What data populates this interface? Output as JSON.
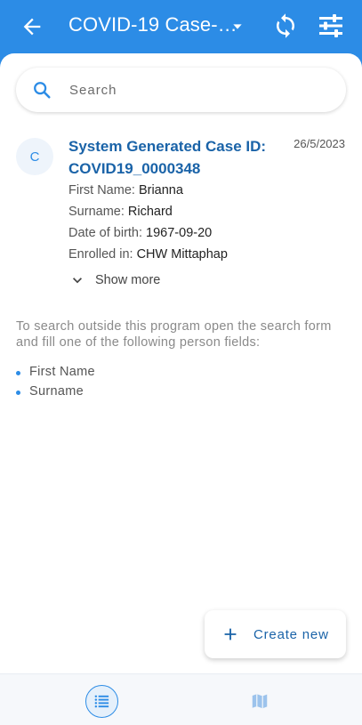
{
  "header": {
    "title": "COVID-19 Case-…"
  },
  "search": {
    "placeholder": "Search"
  },
  "card": {
    "avatar_letter": "C",
    "case_id_line1": "System Generated Case ID:",
    "case_id_line2": "COVID19_0000348",
    "date": "26/5/2023",
    "attributes": [
      {
        "label": "First Name:",
        "value": "Brianna"
      },
      {
        "label": "Surname:",
        "value": "Richard"
      },
      {
        "label": "Date of birth:",
        "value": "1967-09-20"
      },
      {
        "label": "Enrolled in:",
        "value": "CHW Mittaphap"
      }
    ],
    "show_more": "Show more"
  },
  "hint": {
    "text": "To search outside this program open the search form and fill one of the following person fields:",
    "fields": [
      "First Name",
      "Surname"
    ]
  },
  "fab": {
    "label": "Create new"
  },
  "colors": {
    "primary": "#2C8CE6",
    "link": "#1A63A8"
  },
  "icons": {
    "back": "arrow-left-icon",
    "dropdown": "caret-down-icon",
    "sync": "sync-icon",
    "filter": "filter-sliders-icon",
    "search": "search-icon",
    "expand": "chevron-down-icon",
    "add": "plus-icon",
    "list": "list-icon",
    "map": "map-icon"
  }
}
